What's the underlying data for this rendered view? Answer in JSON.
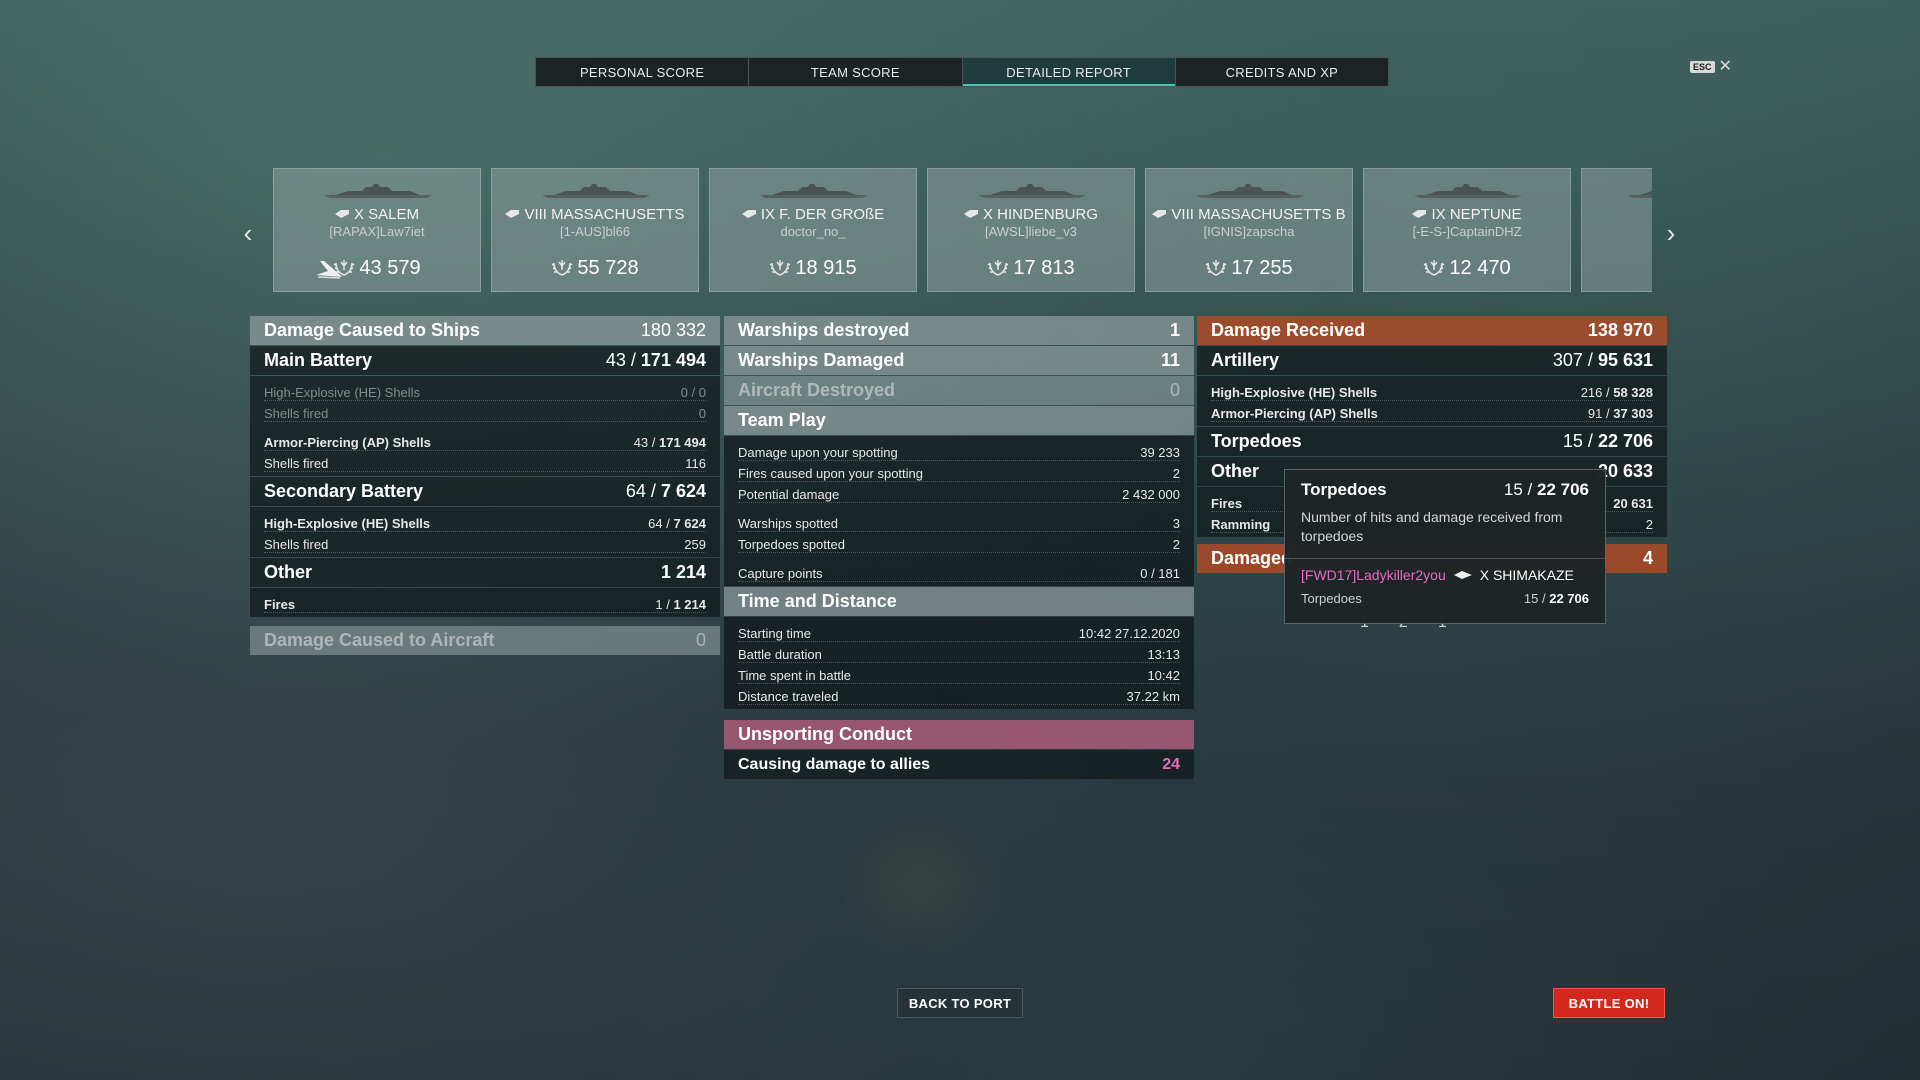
{
  "tabs": [
    "PERSONAL SCORE",
    "TEAM SCORE",
    "DETAILED REPORT",
    "CREDITS AND XP"
  ],
  "active_tab": "DETAILED REPORT",
  "esc": {
    "key": "ESC",
    "close": "✕"
  },
  "nav": {
    "prev": "‹",
    "next": "›"
  },
  "ships": [
    {
      "tier": "X",
      "name": "SALEM",
      "player": "[RAPAX]Law7iet",
      "score": "43 579",
      "icon": "plane-icon"
    },
    {
      "tier": "VIII",
      "name": "MASSACHUSETTS",
      "player": "[1-AUS]bl66",
      "score": "55 728"
    },
    {
      "tier": "IX",
      "name": "F. DER GROßE",
      "player": "doctor_no_",
      "score": "18 915"
    },
    {
      "tier": "X",
      "name": "HINDENBURG",
      "player": "[AWSL]liebe_v3",
      "score": "17 813"
    },
    {
      "tier": "VIII",
      "name": "MASSACHUSETTS B",
      "player": "[IGNIS]zapscha",
      "score": "17 255"
    },
    {
      "tier": "IX",
      "name": "NEPTUNE",
      "player": "[-E-S-]CaptainDHZ",
      "score": "12 470"
    }
  ],
  "left": {
    "damage_ships": {
      "label": "Damage Caused to Ships",
      "value": "180 332"
    },
    "main_battery": {
      "label": "Main Battery",
      "hits": "43 /",
      "dmg": "171 494"
    },
    "mb_he": {
      "label": "High-Explosive (HE) Shells",
      "value": "0 / 0"
    },
    "mb_he_fired": {
      "label": "Shells fired",
      "value": "0"
    },
    "mb_ap": {
      "label": "Armor-Piercing (AP) Shells",
      "hits": "43 /",
      "dmg": "171 494"
    },
    "mb_ap_fired": {
      "label": "Shells fired",
      "value": "116"
    },
    "secondary": {
      "label": "Secondary Battery",
      "hits": "64 /",
      "dmg": "7 624"
    },
    "sb_he": {
      "label": "High-Explosive (HE) Shells",
      "hits": "64 /",
      "dmg": "7 624"
    },
    "sb_he_fired": {
      "label": "Shells fired",
      "value": "259"
    },
    "other": {
      "label": "Other",
      "value": "1 214"
    },
    "fires": {
      "label": "Fires",
      "hits": "1 /",
      "dmg": "1 214"
    },
    "aircraft": {
      "label": "Damage Caused to Aircraft",
      "value": "0"
    }
  },
  "middle": {
    "warships_destroyed": {
      "label": "Warships destroyed",
      "value": "1"
    },
    "warships_damaged": {
      "label": "Warships Damaged",
      "value": "11"
    },
    "aircraft_destroyed": {
      "label": "Aircraft Destroyed",
      "value": "0"
    },
    "team_play": "Team Play",
    "tp_rows": [
      {
        "label": "Damage upon your spotting",
        "value": "39 233"
      },
      {
        "label": "Fires caused upon your spotting",
        "value": "2"
      },
      {
        "label": "Potential damage",
        "value": "2 432 000"
      }
    ],
    "tp_rows2": [
      {
        "label": "Warships spotted",
        "value": "3"
      },
      {
        "label": "Torpedoes spotted",
        "value": "2"
      }
    ],
    "tp_rows3": [
      {
        "label": "Capture points",
        "value": "0 / 181"
      }
    ],
    "time_distance": "Time and Distance",
    "td_rows": [
      {
        "label": "Starting time",
        "value": "10:42  27.12.2020"
      },
      {
        "label": "Battle duration",
        "value": "13:13"
      },
      {
        "label": "Time spent in battle",
        "value": "10:42"
      },
      {
        "label": "Distance traveled",
        "value": "37.22 km"
      }
    ],
    "unsporting": "Unsporting Conduct",
    "allies": {
      "label": "Causing damage to allies",
      "value": "24"
    }
  },
  "right": {
    "damage_received": {
      "label": "Damage Received",
      "value": "138 970"
    },
    "artillery": {
      "label": "Artillery",
      "hits": "307 /",
      "dmg": "95 631"
    },
    "art_he": {
      "label": "High-Explosive (HE) Shells",
      "hits": "216 /",
      "dmg": "58 328"
    },
    "art_ap": {
      "label": "Armor-Piercing (AP) Shells",
      "hits": "91 /",
      "dmg": "37 303"
    },
    "torpedoes": {
      "label": "Torpedoes",
      "hits": "15 /",
      "dmg": "22 706"
    },
    "other": {
      "label": "Other",
      "value": "20 633"
    },
    "fires": {
      "label": "Fires",
      "value": "20 631"
    },
    "ramming": {
      "label": "Ramming",
      "value": "2"
    },
    "damaged": {
      "label": "Damaged",
      "value": "4"
    }
  },
  "tooltip": {
    "title": "Torpedoes",
    "hits": "15 /",
    "dmg": "22 706",
    "desc": "Number of hits and damage received from torpedoes",
    "player": "[FWD17]Ladykiller2you",
    "ship": "X SHIMAKAZE",
    "type": "Torpedoes",
    "type_hits": "15 /",
    "type_dmg": "22 706"
  },
  "peek_values": [
    "1",
    "2",
    "1"
  ],
  "buttons": {
    "back": "BACK TO PORT",
    "battle": "BATTLE ON!"
  },
  "colors": {
    "accent": "#3ec9b3",
    "battle": "#d3261c",
    "pink": "#e86cc0",
    "orange": "#aa4b28"
  }
}
